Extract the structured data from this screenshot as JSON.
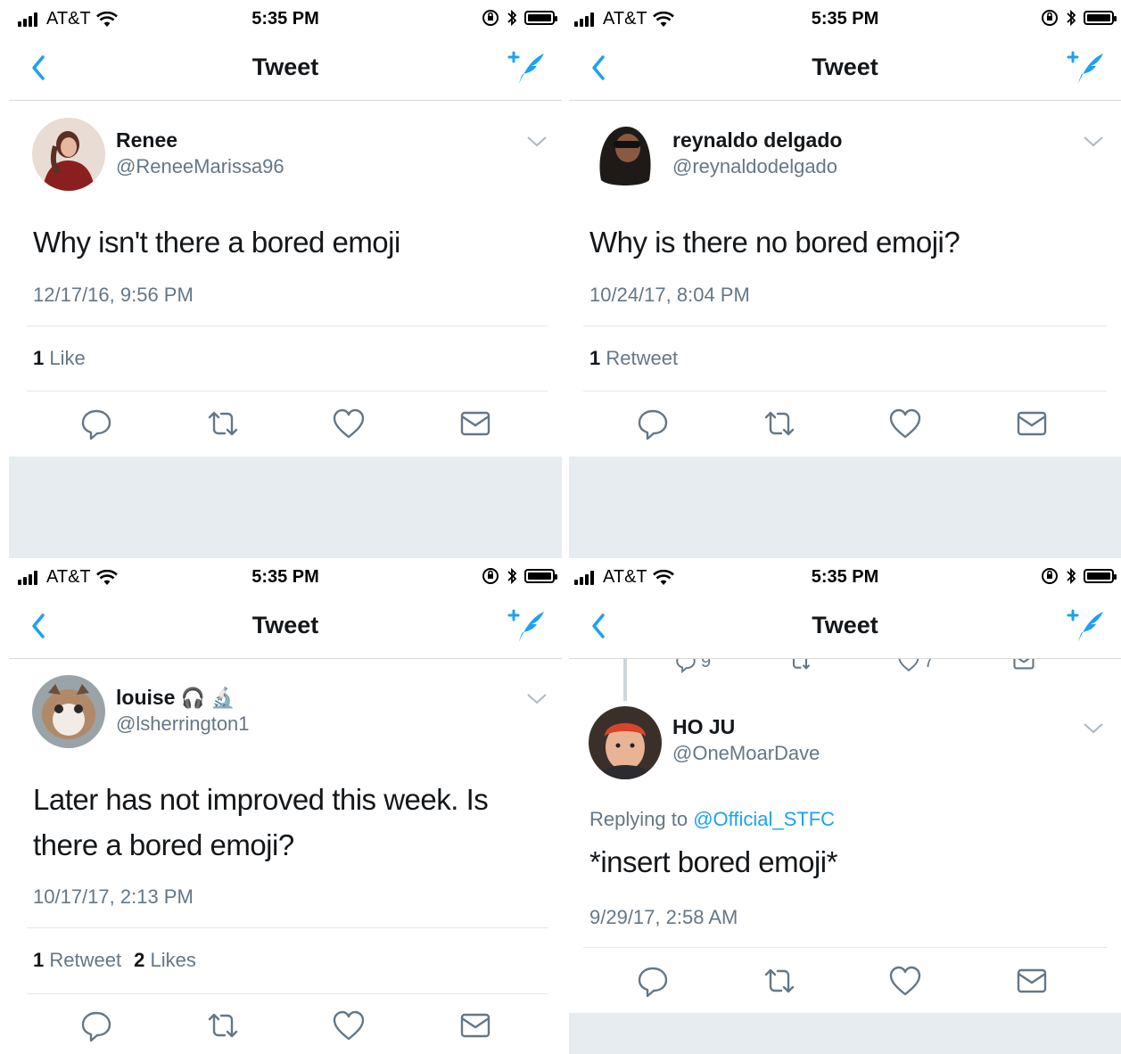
{
  "status_bar": {
    "carrier": "AT&T",
    "time": "5:35 PM"
  },
  "nav": {
    "title": "Tweet"
  },
  "colors": {
    "accent": "#1da1f2",
    "secondary_text": "#657786",
    "band": "#e6ecf0"
  },
  "icons": {
    "back": "chevron-left-icon",
    "compose": "compose-tweet-icon",
    "reply": "reply-icon",
    "retweet": "retweet-icon",
    "like": "heart-icon",
    "dm": "envelope-icon",
    "caret": "chevron-down-icon"
  },
  "panels": [
    {
      "name": "Renee",
      "handle": "@ReneeMarissa96",
      "text_lines": [
        "Why isn't there a bored emoji"
      ],
      "timestamp": "12/17/16, 9:56 PM",
      "stats": [
        {
          "count": "1",
          "label": "Like"
        }
      ]
    },
    {
      "name": "reynaldo delgado",
      "handle": "@reynaldodelgado",
      "text_lines": [
        "Why is there no bored emoji?"
      ],
      "timestamp": "10/24/17, 8:04 PM",
      "stats": [
        {
          "count": "1",
          "label": "Retweet"
        }
      ]
    },
    {
      "name": "louise",
      "name_emoji": "🎧 🔬",
      "handle": "@lsherrington1",
      "text_lines": [
        "Later has not improved this week. Is",
        "there a bored emoji?"
      ],
      "timestamp": "10/17/17, 2:13 PM",
      "stats": [
        {
          "count": "1",
          "label": "Retweet"
        },
        {
          "count": "2",
          "label": "Likes"
        }
      ]
    },
    {
      "name": "HO JU",
      "handle": "@OneMoarDave",
      "replying_prefix": "Replying to",
      "replying_to": "@Official_STFC",
      "text_lines": [
        "*insert bored emoji*"
      ],
      "timestamp": "9/29/17, 2:58 AM",
      "prev_tweet_counts": {
        "reply": "9",
        "like": "7"
      }
    }
  ]
}
